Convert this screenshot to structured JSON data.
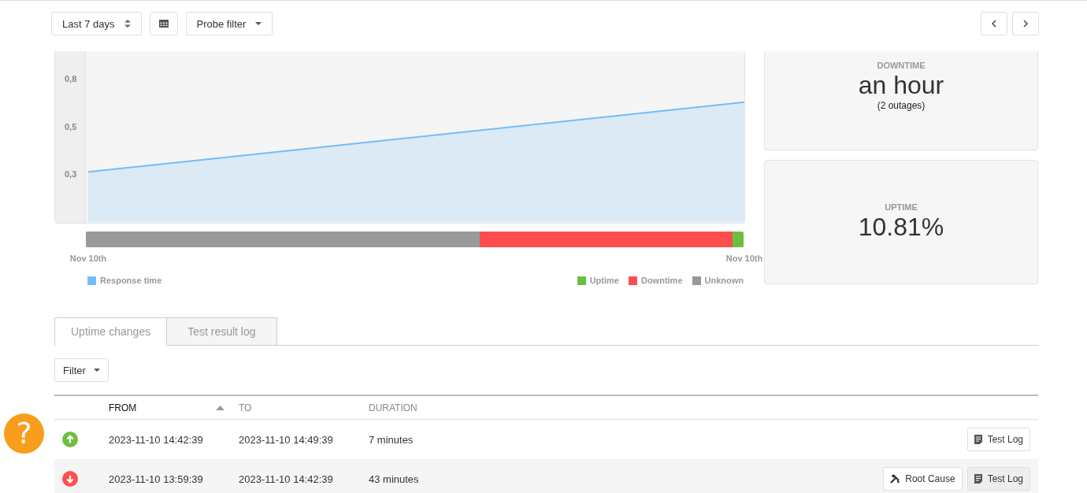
{
  "toolbar": {
    "range": "Last 7 days",
    "probe_filter": "Probe filter"
  },
  "chart": {
    "chart_data": {
      "type": "area",
      "categories": [
        "Nov 10th",
        "Nov 10th"
      ],
      "series": [
        {
          "name": "Response time",
          "color": "#74bcf7",
          "values": [
            0.267,
            0.633
          ]
        }
      ],
      "ylim": [
        0,
        0.9
      ],
      "yticks": [
        {
          "value": 0.25,
          "label": "0,3"
        },
        {
          "value": 0.5,
          "label": "0,5"
        },
        {
          "value": 0.75,
          "label": "0,8"
        }
      ]
    },
    "legend": [
      {
        "label": "Uptime",
        "color": "#6cbf3f"
      },
      {
        "label": "Downtime",
        "color": "#ff4d4d"
      },
      {
        "label": "Unknown",
        "color": "#999999"
      }
    ]
  },
  "cards": [
    {
      "label": "DOWNTIME",
      "value": "an hour",
      "note": "(2 outages)"
    },
    {
      "label": "UPTIME",
      "value": "10.81%"
    }
  ],
  "tabs": [
    {
      "label": "Uptime changes",
      "selected": true
    },
    {
      "label": "Test result log",
      "selected": false
    }
  ],
  "filter": "Filter",
  "table": {
    "columns": [
      "FROM",
      "TO",
      "DURATION"
    ],
    "rows": [
      {
        "kind": "up",
        "from": "2023-11-10 14:42:39",
        "to": "2023-11-10 14:49:39",
        "duration": "7 minutes",
        "actions": [
          {
            "kind": "test_log",
            "label": "Test Log"
          }
        ]
      },
      {
        "kind": "down",
        "from": "2023-11-10 13:59:39",
        "to": "2023-11-10 14:42:39",
        "duration": "43 minutes",
        "actions": [
          {
            "kind": "root_cause",
            "label": "Root Cause"
          },
          {
            "kind": "test_log",
            "label": "Test Log"
          }
        ]
      }
    ]
  },
  "help": "?"
}
